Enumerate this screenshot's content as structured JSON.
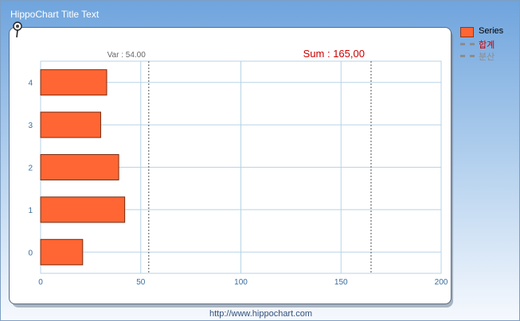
{
  "header": {
    "title": "HippoChart Title Text"
  },
  "footer": {
    "url": "http://www.hippochart.com"
  },
  "legend": {
    "items": [
      {
        "label": "Series",
        "kind": "swatch",
        "color": "#ff6633"
      },
      {
        "label": "합계",
        "kind": "dash",
        "color": "#cc0000"
      },
      {
        "label": "분산",
        "kind": "dash",
        "color": "#8c8c8c"
      }
    ]
  },
  "chart_data": {
    "type": "bar",
    "orientation": "horizontal",
    "categories": [
      "0",
      "1",
      "2",
      "3",
      "4"
    ],
    "series": [
      {
        "name": "Series",
        "values": [
          21,
          42,
          39,
          30,
          33
        ],
        "color": "#ff6633"
      }
    ],
    "xlim": [
      0,
      200
    ],
    "x_ticks": [
      0,
      50,
      100,
      150,
      200
    ],
    "grid": true,
    "legend_position": "right",
    "reference_lines": [
      {
        "name": "합계",
        "label": "Sum : 165,00",
        "value": 165,
        "color": "#cc0000"
      },
      {
        "name": "분산",
        "label": "Var : 54.00",
        "value": 54,
        "color": "#666666"
      }
    ]
  }
}
